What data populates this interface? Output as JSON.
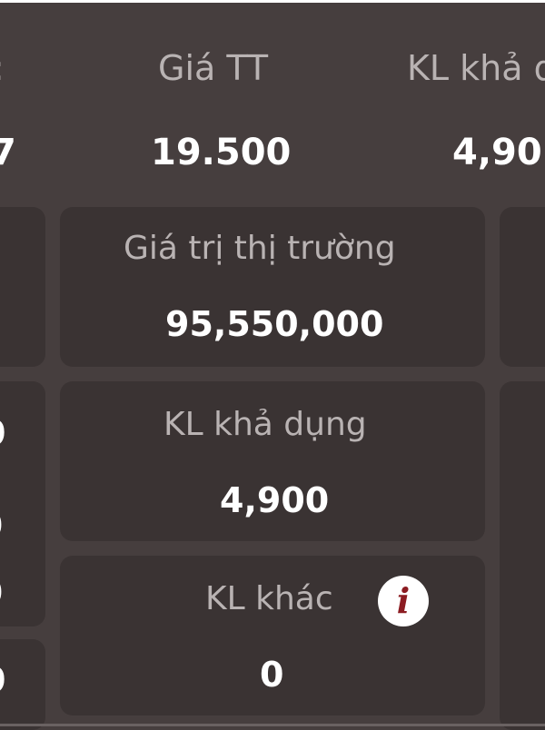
{
  "header": {
    "left_value_fragment": "7",
    "col_price_label": "Giá TT",
    "col_price_value": "19.500",
    "col_avail_label": "KL khả d",
    "col_avail_value": "4,90"
  },
  "cards": {
    "market_value": {
      "label": "Giá trị thị trường",
      "value": "95,550,000"
    },
    "available_qty": {
      "label": "KL khả dụng",
      "value": "4,900"
    },
    "other_qty": {
      "label": "KL khác",
      "value": "0",
      "info_glyph": "i"
    }
  },
  "left_column_fragments": {
    "row1_value": "0",
    "row1_sub1": "0",
    "row1_sub2": "0",
    "row2_value": "0"
  },
  "colors": {
    "background": "#463e3e",
    "card": "#3a3333",
    "label": "#b9b3b3",
    "info_accent": "#8c1c22"
  },
  "icons": {
    "info": "info-icon"
  }
}
